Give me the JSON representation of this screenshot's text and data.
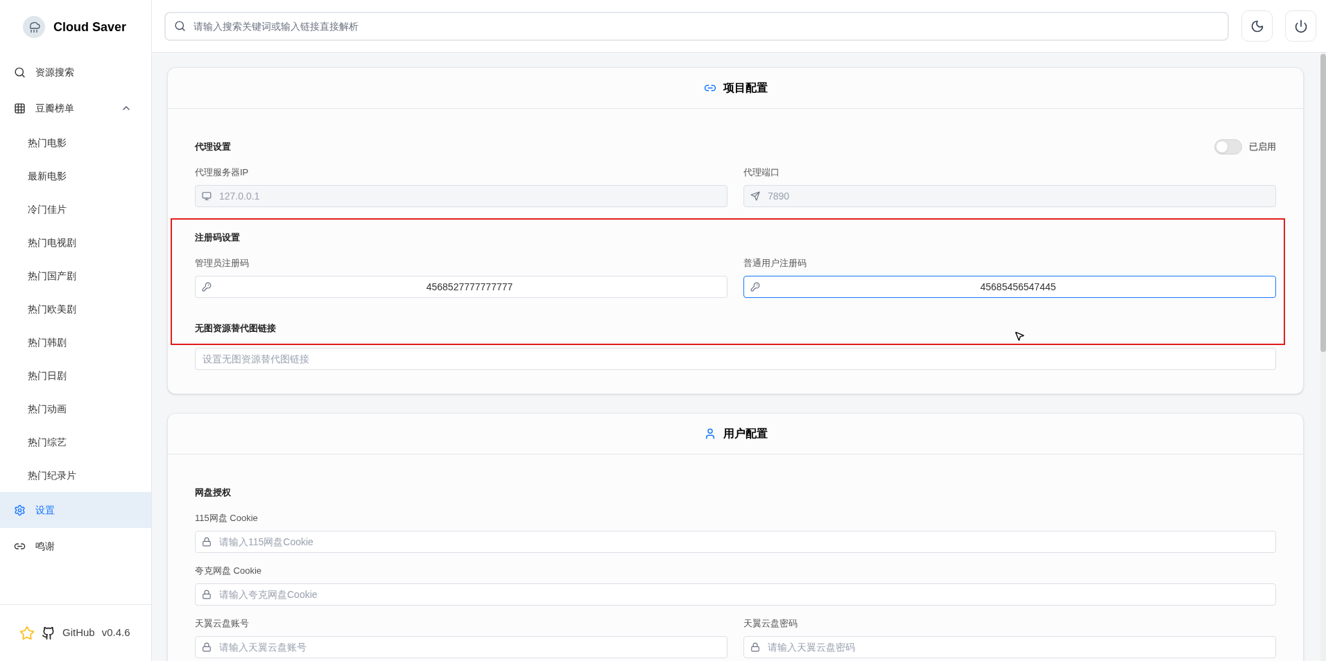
{
  "sidebar": {
    "brand": "Cloud Saver",
    "items": [
      {
        "label": "资源搜索",
        "kind": "search",
        "selected": false
      },
      {
        "label": "豆瓣榜单",
        "kind": "grid",
        "selected": false,
        "expanded": true,
        "children": [
          {
            "label": "热门电影",
            "selected": false
          },
          {
            "label": "最新电影",
            "selected": false
          },
          {
            "label": "冷门佳片",
            "selected": false
          },
          {
            "label": "热门电视剧",
            "selected": false
          },
          {
            "label": "热门国产剧",
            "selected": false
          },
          {
            "label": "热门欧美剧",
            "selected": false
          },
          {
            "label": "热门韩剧",
            "selected": false
          },
          {
            "label": "热门日剧",
            "selected": false
          },
          {
            "label": "热门动画",
            "selected": false
          },
          {
            "label": "热门综艺",
            "selected": false
          },
          {
            "label": "热门纪录片",
            "selected": false
          }
        ]
      },
      {
        "label": "设置",
        "kind": "gear",
        "selected": true
      },
      {
        "label": "鸣谢",
        "kind": "link",
        "selected": false
      }
    ],
    "footer": {
      "github": "GitHub",
      "version": "v0.4.6"
    }
  },
  "topbar": {
    "search_placeholder": "请输入搜索关键词或输入链接直接解析"
  },
  "sections": [
    {
      "title": "项目配置",
      "kind": "project",
      "groups": [
        {
          "title": "代理设置",
          "toggle": {
            "label": "已启用",
            "on": false
          },
          "rows": [
            [
              {
                "label": "代理服务器IP",
                "kind": "monitor",
                "value": "127.0.0.1",
                "disabled": true,
                "focused": false
              },
              {
                "label": "代理端口",
                "kind": "send",
                "value": "7890",
                "disabled": true,
                "focused": false
              }
            ]
          ]
        },
        {
          "title": "注册码设置",
          "highlighted": true,
          "rows": [
            [
              {
                "label": "管理员注册码",
                "kind": "key",
                "value": "4568527777777777",
                "focused": false
              },
              {
                "label": "普通用户注册码",
                "kind": "key",
                "value": "45685456547445",
                "focused": true
              }
            ]
          ]
        },
        {
          "title": "无图资源替代图链接",
          "rows": [
            [
              {
                "kind": "plain",
                "placeholder": "设置无图资源替代图链接",
                "focused": false
              }
            ]
          ]
        }
      ]
    },
    {
      "title": "用户配置",
      "kind": "user",
      "groups": [
        {
          "title": "网盘授权",
          "rows": [
            [
              {
                "label": "115网盘 Cookie",
                "kind": "lock",
                "placeholder": "请输入115网盘Cookie",
                "focused": false
              }
            ],
            [
              {
                "label": "夸克网盘 Cookie",
                "kind": "lock",
                "placeholder": "请输入夸克网盘Cookie",
                "focused": false
              }
            ],
            [
              {
                "label": "天翼云盘账号",
                "kind": "lock",
                "placeholder": "请输入天翼云盘账号",
                "focused": false
              },
              {
                "label": "天翼云盘密码",
                "kind": "lock",
                "placeholder": "请输入天翼云盘密码",
                "focused": false
              }
            ]
          ]
        }
      ]
    }
  ]
}
